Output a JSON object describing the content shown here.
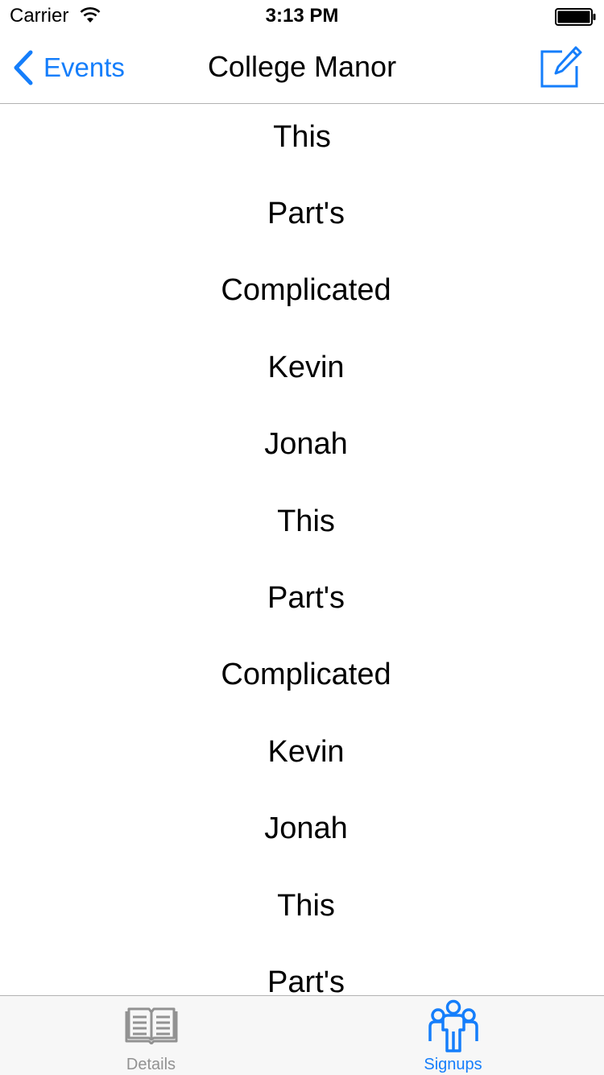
{
  "status_bar": {
    "carrier": "Carrier",
    "time": "3:13 PM"
  },
  "nav": {
    "back_label": "Events",
    "title": "College Manor",
    "compose_icon": "compose-icon"
  },
  "list": {
    "items": [
      "This",
      "Part's",
      "Complicated",
      "Kevin",
      "Jonah",
      "This",
      "Part's",
      "Complicated",
      "Kevin",
      "Jonah",
      "This",
      "Part's"
    ]
  },
  "tabs": [
    {
      "label": "Details",
      "icon": "book-icon",
      "selected": false
    },
    {
      "label": "Signups",
      "icon": "people-icon",
      "selected": true
    }
  ],
  "colors": {
    "accent": "#157efb",
    "inactive": "#929292",
    "text": "#000000"
  }
}
